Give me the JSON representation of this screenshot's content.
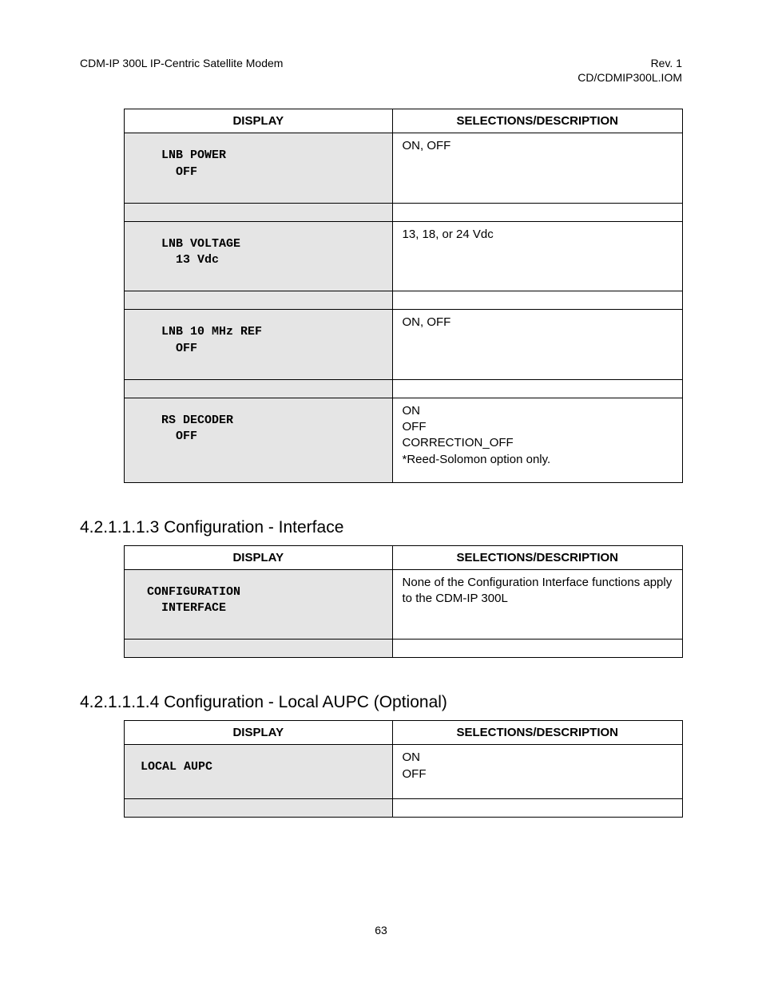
{
  "header": {
    "left": "CDM-IP 300L IP-Centric Satellite Modem",
    "right1": "Rev. 1",
    "right2": "CD/CDMIP300L.IOM"
  },
  "tables": {
    "t1": {
      "h1": "DISPLAY",
      "h2": "SELECTIONS/DESCRIPTION",
      "rows": [
        {
          "disp": "LNB POWER\n  OFF",
          "desc": "ON, OFF"
        },
        {
          "disp": "LNB VOLTAGE\n  13 Vdc",
          "desc": "13, 18, or 24 Vdc"
        },
        {
          "disp": "LNB 10 MHz REF\n  OFF",
          "desc": "ON, OFF"
        },
        {
          "disp": "RS DECODER\n  OFF",
          "desc": "ON\nOFF\nCORRECTION_OFF\n*Reed-Solomon option only."
        }
      ]
    },
    "t2": {
      "h1": "DISPLAY",
      "h2": "SELECTIONS/DESCRIPTION",
      "rows": [
        {
          "disp": "CONFIGURATION\n  INTERFACE",
          "desc": "None of the Configuration Interface functions apply to the CDM-IP 300L"
        }
      ]
    },
    "t3": {
      "h1": "DISPLAY",
      "h2": "SELECTIONS/DESCRIPTION",
      "rows": [
        {
          "disp": "LOCAL AUPC",
          "desc": "ON\nOFF"
        }
      ]
    }
  },
  "sections": {
    "s1": "4.2.1.1.1.3  Configuration - Interface",
    "s2": "4.2.1.1.1.4  Configuration - Local AUPC (Optional)"
  },
  "pagenum": "63"
}
